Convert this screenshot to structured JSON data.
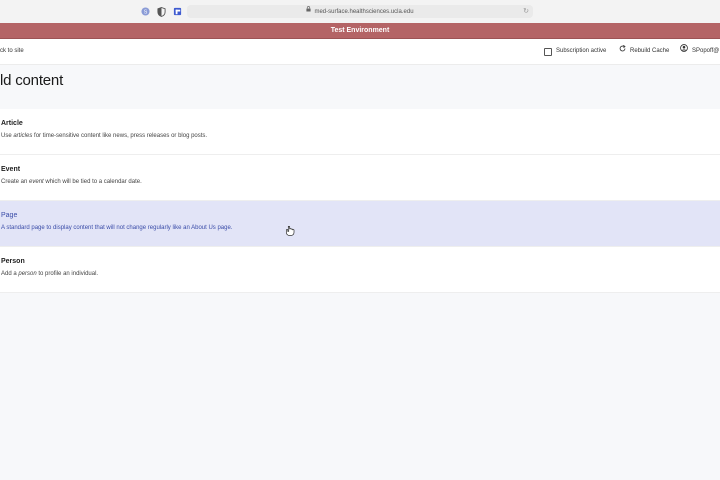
{
  "browser": {
    "url": "med-surface.healthsciences.ucla.edu"
  },
  "banner": {
    "text": "Test Environment"
  },
  "toolbar": {
    "back_label": "ck to site",
    "subscription_label": "Subscription active",
    "rebuild_label": "Rebuild Cache",
    "user_label": "SPopoff@"
  },
  "page": {
    "title": "ld content"
  },
  "content_types": [
    {
      "title": "Article",
      "desc_before": "Use ",
      "desc_em": "articles",
      "desc_after": " for time-sensitive content like news, press releases or blog posts."
    },
    {
      "title": "Event",
      "desc_before": "Create an ",
      "desc_em": "event",
      "desc_after": " which will be tied to a calendar date."
    },
    {
      "title": "Page",
      "desc_before": "A standard page to display content that will not change regularly like an About Us page.",
      "desc_em": "",
      "desc_after": ""
    },
    {
      "title": "Person",
      "desc_before": "Add a ",
      "desc_em": "person",
      "desc_after": " to profile an individual."
    }
  ],
  "colors": {
    "banner": "#b46466",
    "hover_row": "#e2e4f7",
    "hover_text": "#3a4ca8"
  }
}
